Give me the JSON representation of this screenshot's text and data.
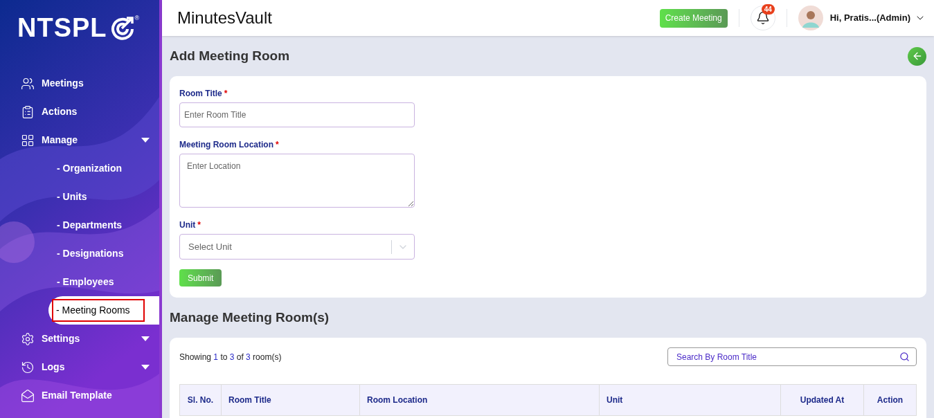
{
  "sidebar": {
    "logo": "NTSPL",
    "logo_mark": "®",
    "items": [
      {
        "label": "Meetings",
        "selected": false
      },
      {
        "label": "Actions",
        "selected": false
      },
      {
        "label": "Manage",
        "selected": false,
        "expanded": true,
        "children": [
          {
            "label": "- Organization",
            "selected": false
          },
          {
            "label": "- Units",
            "selected": false
          },
          {
            "label": "- Departments",
            "selected": false
          },
          {
            "label": "- Designations",
            "selected": false
          },
          {
            "label": "- Employees",
            "selected": false
          },
          {
            "label": "- Meeting Rooms",
            "selected": true
          }
        ]
      },
      {
        "label": "Settings",
        "selected": false,
        "expanded": false
      },
      {
        "label": "Logs",
        "selected": false,
        "expanded": false
      },
      {
        "label": "Email Template",
        "selected": false
      }
    ]
  },
  "header": {
    "app_title": "MinutesVault",
    "create_button": "Create Meeting",
    "notification_count": "44",
    "user": "Hi, Pratis...(Admin)"
  },
  "form": {
    "title": "Add Meeting Room",
    "fields": [
      {
        "kind": "input",
        "label": "Room Title",
        "required_mark": "*",
        "placeholder": "Enter Room Title"
      },
      {
        "kind": "textarea",
        "label": "Meeting Room Location",
        "required_mark": "*",
        "placeholder": "Enter Location"
      },
      {
        "kind": "select",
        "label": "Unit",
        "required_mark": "*",
        "placeholder": "Select Unit"
      }
    ],
    "submit": "Submit"
  },
  "list": {
    "title": "Manage Meeting Room(s)",
    "showing": [
      "Showing",
      "1",
      "to",
      "3",
      "of",
      "3",
      "room(s)"
    ],
    "search": {
      "placeholder": "Search By Room Title"
    },
    "table": {
      "columns": [
        "Sl. No.",
        "Room Title",
        "Room Location",
        "Unit",
        "Updated At",
        "Action"
      ]
    }
  }
}
